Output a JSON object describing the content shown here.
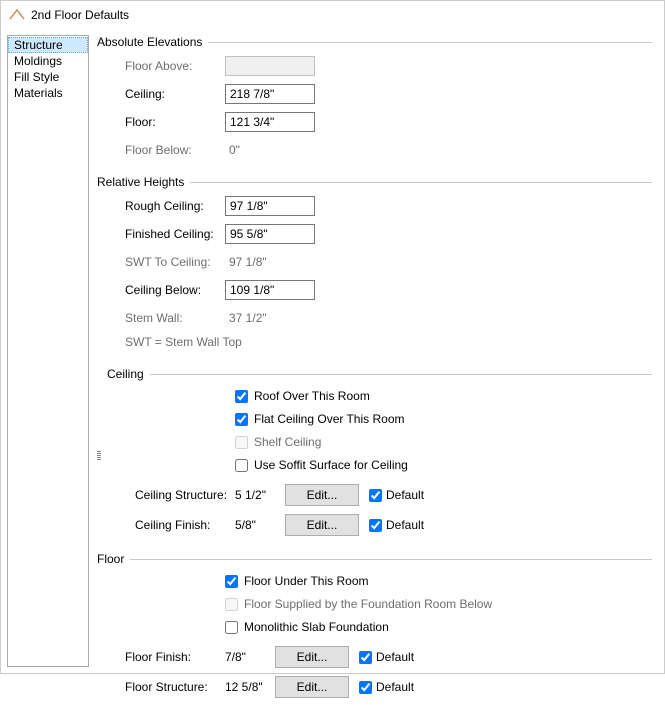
{
  "window": {
    "title": "2nd Floor Defaults"
  },
  "sidebar": {
    "items": [
      {
        "label": "Structure",
        "selected": true
      },
      {
        "label": "Moldings",
        "selected": false
      },
      {
        "label": "Fill Style",
        "selected": false
      },
      {
        "label": "Materials",
        "selected": false
      }
    ]
  },
  "absoluteElevations": {
    "title": "Absolute Elevations",
    "floorAbove": {
      "label": "Floor Above:",
      "value": "",
      "enabled": false
    },
    "ceiling": {
      "label": "Ceiling:",
      "value": "218 7/8\"",
      "enabled": true
    },
    "floor": {
      "label": "Floor:",
      "value": "121 3/4\"",
      "enabled": true
    },
    "floorBelow": {
      "label": "Floor Below:",
      "value": "0\"",
      "enabled": false
    }
  },
  "relativeHeights": {
    "title": "Relative Heights",
    "roughCeiling": {
      "label": "Rough Ceiling:",
      "value": "97 1/8\"",
      "enabled": true
    },
    "finishedCeiling": {
      "label": "Finished Ceiling:",
      "value": "95 5/8\"",
      "enabled": true
    },
    "swtToCeiling": {
      "label": "SWT To Ceiling:",
      "value": "97 1/8\"",
      "enabled": false
    },
    "ceilingBelow": {
      "label": "Ceiling Below:",
      "value": "109 1/8\"",
      "enabled": true
    },
    "stemWall": {
      "label": "Stem Wall:",
      "value": "37 1/2\"",
      "enabled": false
    },
    "hint": "SWT = Stem Wall Top"
  },
  "ceiling": {
    "title": "Ceiling",
    "roofOver": {
      "label": "Roof Over This Room",
      "checked": true,
      "enabled": true
    },
    "flatCeiling": {
      "label": "Flat Ceiling Over This Room",
      "checked": true,
      "enabled": true
    },
    "shelfCeiling": {
      "label": "Shelf Ceiling",
      "checked": false,
      "enabled": false
    },
    "useSoffit": {
      "label": "Use Soffit Surface for Ceiling",
      "checked": false,
      "enabled": true
    },
    "ceilingStructure": {
      "label": "Ceiling Structure:",
      "value": "5 1/2\"",
      "edit": "Edit...",
      "defaultLabel": "Default",
      "defaultChecked": true
    },
    "ceilingFinish": {
      "label": "Ceiling Finish:",
      "value": "5/8\"",
      "edit": "Edit...",
      "defaultLabel": "Default",
      "defaultChecked": true
    }
  },
  "floor": {
    "title": "Floor",
    "floorUnder": {
      "label": "Floor Under This Room",
      "checked": true,
      "enabled": true
    },
    "floorSupplied": {
      "label": "Floor Supplied by the Foundation Room Below",
      "checked": false,
      "enabled": false
    },
    "monoSlab": {
      "label": "Monolithic Slab Foundation",
      "checked": false,
      "enabled": true
    },
    "floorFinish": {
      "label": "Floor Finish:",
      "value": "7/8\"",
      "edit": "Edit...",
      "defaultLabel": "Default",
      "defaultChecked": true
    },
    "floorStructure": {
      "label": "Floor Structure:",
      "value": "12 5/8\"",
      "edit": "Edit...",
      "defaultLabel": "Default",
      "defaultChecked": true
    }
  }
}
